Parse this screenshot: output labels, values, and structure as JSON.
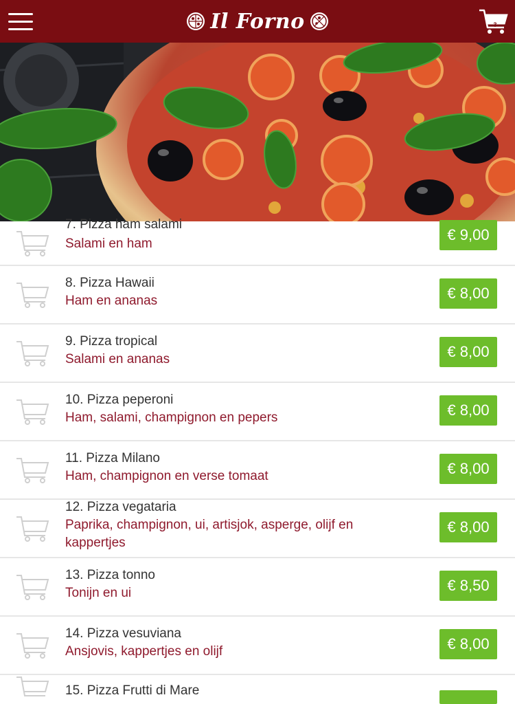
{
  "header": {
    "title": "Il Forno",
    "cart_count": "3",
    "brand_color": "#7a0d12"
  },
  "hero": {
    "image": "pizza-photo"
  },
  "menu": {
    "price_color": "#6dbd2b",
    "description_color": "#8f1a2d",
    "items": [
      {
        "name": "7. Pizza ham salami",
        "description": "Salami en ham",
        "price": "€ 9,00"
      },
      {
        "name": "8. Pizza Hawaii",
        "description": "Ham en ananas",
        "price": "€ 8,00"
      },
      {
        "name": "9. Pizza tropical",
        "description": "Salami en ananas",
        "price": "€ 8,00"
      },
      {
        "name": "10. Pizza peperoni",
        "description": "Ham, salami, champignon en pepers",
        "price": "€ 8,00"
      },
      {
        "name": "11. Pizza Milano",
        "description": "Ham, champignon en verse tomaat",
        "price": "€ 8,00"
      },
      {
        "name": "12. Pizza vegataria",
        "description": "Paprika, champignon, ui, artisjok, asperge, olijf en kappertjes",
        "price": "€ 8,00"
      },
      {
        "name": "13. Pizza tonno",
        "description": "Tonijn en ui",
        "price": "€ 8,50"
      },
      {
        "name": "14. Pizza vesuviana",
        "description": "Ansjovis, kappertjes en olijf",
        "price": "€ 8,00"
      },
      {
        "name": "15. Pizza Frutti di Mare",
        "description": "",
        "price": ""
      }
    ]
  }
}
